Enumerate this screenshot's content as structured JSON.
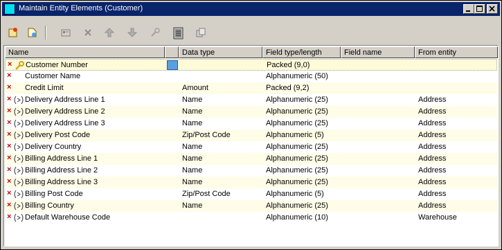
{
  "window": {
    "title": "Maintain Entity Elements (Customer)"
  },
  "columns": [
    "Name",
    "Data type",
    "Field type/length",
    "Field name",
    "From entity"
  ],
  "rows": [
    {
      "name": "Customer Number",
      "data_type": "",
      "field_type": "Packed (9,0)",
      "field_name": "",
      "from_entity": "",
      "icon": "key-icon",
      "selected": true
    },
    {
      "name": "Customer Name",
      "data_type": "",
      "field_type": "Alphanumeric (50)",
      "field_name": "",
      "from_entity": "",
      "icon": ""
    },
    {
      "name": "Credit Limit",
      "data_type": "Amount",
      "field_type": "Packed (9,2)",
      "field_name": "",
      "from_entity": "",
      "icon": ""
    },
    {
      "name": "Delivery Address Line 1",
      "data_type": "Name",
      "field_type": "Alphanumeric (25)",
      "field_name": "",
      "from_entity": "Address",
      "icon": "foreign-ref-icon"
    },
    {
      "name": "Delivery Address Line 2",
      "data_type": "Name",
      "field_type": "Alphanumeric (25)",
      "field_name": "",
      "from_entity": "Address",
      "icon": "foreign-ref-icon"
    },
    {
      "name": "Delivery Address Line 3",
      "data_type": "Name",
      "field_type": "Alphanumeric (25)",
      "field_name": "",
      "from_entity": "Address",
      "icon": "foreign-ref-icon"
    },
    {
      "name": "Delivery Post Code",
      "data_type": "Zip/Post Code",
      "field_type": "Alphanumeric (5)",
      "field_name": "",
      "from_entity": "Address",
      "icon": "foreign-ref-icon"
    },
    {
      "name": "Delivery Country",
      "data_type": "Name",
      "field_type": "Alphanumeric (25)",
      "field_name": "",
      "from_entity": "Address",
      "icon": "foreign-ref-icon"
    },
    {
      "name": "Billing Address Line 1",
      "data_type": "Name",
      "field_type": "Alphanumeric (25)",
      "field_name": "",
      "from_entity": "Address",
      "icon": "foreign-ref-icon"
    },
    {
      "name": "Billing Address Line 2",
      "data_type": "Name",
      "field_type": "Alphanumeric (25)",
      "field_name": "",
      "from_entity": "Address",
      "icon": "foreign-ref-icon"
    },
    {
      "name": "Billing Address Line 3",
      "data_type": "Name",
      "field_type": "Alphanumeric (25)",
      "field_name": "",
      "from_entity": "Address",
      "icon": "foreign-ref-icon"
    },
    {
      "name": "Billing Post Code",
      "data_type": "Zip/Post Code",
      "field_type": "Alphanumeric (5)",
      "field_name": "",
      "from_entity": "Address",
      "icon": "foreign-ref-icon"
    },
    {
      "name": "Billing Country",
      "data_type": "Name",
      "field_type": "Alphanumeric (25)",
      "field_name": "",
      "from_entity": "Address",
      "icon": "foreign-ref-icon"
    },
    {
      "name": "Default Warehouse Code",
      "data_type": "",
      "field_type": "Alphanumeric (10)",
      "field_name": "",
      "from_entity": "Warehouse",
      "icon": "foreign-ref-icon"
    }
  ],
  "toolbar": [
    "new-element-icon",
    "new-element-from-icon",
    "properties-icon",
    "delete-icon",
    "move-up-icon",
    "move-down-icon",
    "primary-key-icon",
    "notes-icon",
    "copy-icon"
  ],
  "colors": {
    "titlebar": "#0a246a",
    "window_bg": "#d4d0c8",
    "row_alt": "#fffde8",
    "marker": "#c00000"
  }
}
